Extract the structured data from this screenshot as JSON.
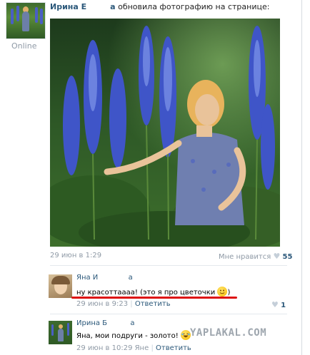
{
  "post": {
    "author": "Ирина Е",
    "author_suffix": "а",
    "action": "обновила фотографию на странице:",
    "status": "Online",
    "date": "29 июн в 1:29",
    "like_label": "Мне нравится",
    "like_count": "55"
  },
  "comments": [
    {
      "name": "Яна И",
      "name_suffix": "а",
      "text": "ну красоттаааа! (это я про цветочки",
      "text_close": ")",
      "time": "29 июн в 9:23",
      "reply": "Ответить",
      "likes": "1"
    },
    {
      "name": "Ирина Б",
      "name_suffix": "а",
      "text": "Яна, мои подруги - золото!",
      "time": "29 июн в 10:29 Яне",
      "reply": "Ответить"
    }
  ],
  "watermark": "YAPLAKAL.COM",
  "colors": {
    "link": "#2b587a",
    "muted": "#8f9aa6",
    "underline": "#dd1111"
  },
  "icons": [
    "heart-icon",
    "smile-emoji-icon",
    "laugh-emoji-icon"
  ]
}
